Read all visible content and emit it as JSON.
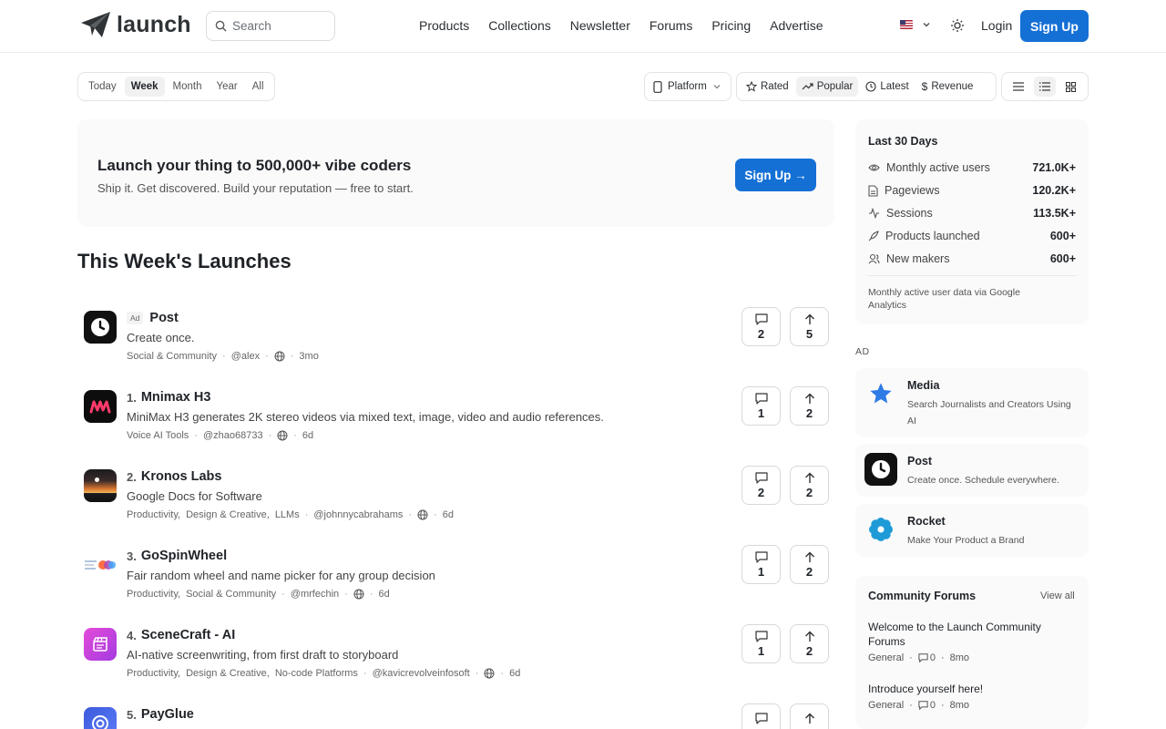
{
  "header": {
    "logo_text": "launch",
    "search_placeholder": "Search",
    "nav": [
      "Products",
      "Collections",
      "Newsletter",
      "Forums",
      "Pricing",
      "Advertise"
    ],
    "login": "Login",
    "signup": "Sign Up"
  },
  "filters": {
    "periods": [
      "Today",
      "Week",
      "Month",
      "Year",
      "All"
    ],
    "active_period": "Week",
    "platform": "Platform",
    "sorts": [
      "Rated",
      "Popular",
      "Latest",
      "Revenue"
    ],
    "active_sort": "Popular"
  },
  "banner": {
    "title": "Launch your thing to 500,000+ vibe coders",
    "subtitle": "Ship it. Get discovered. Build your reputation — free to start.",
    "button": "Sign Up →"
  },
  "section_title": "This Week's Launches",
  "launches": [
    {
      "ad": "Ad",
      "rank": "",
      "title": "Post",
      "tagline": "Create once.",
      "tags": [
        "Social & Community"
      ],
      "user": "@alex",
      "age": "3mo",
      "comments": "2",
      "upvotes": "5"
    },
    {
      "ad": "",
      "rank": "1.",
      "title": "Mnimax H3",
      "tagline": "MiniMax H3 generates 2K stereo videos via mixed text, image, video and audio references.",
      "tags": [
        "Voice AI Tools"
      ],
      "user": "@zhao68733",
      "age": "6d",
      "comments": "1",
      "upvotes": "2"
    },
    {
      "ad": "",
      "rank": "2.",
      "title": "Kronos Labs",
      "tagline": "Google Docs for Software",
      "tags": [
        "Productivity,",
        "Design & Creative,",
        "LLMs"
      ],
      "user": "@johnnycabrahams",
      "age": "6d",
      "comments": "2",
      "upvotes": "2"
    },
    {
      "ad": "",
      "rank": "3.",
      "title": "GoSpinWheel",
      "tagline": "Fair random wheel and name picker for any group decision",
      "tags": [
        "Productivity,",
        "Social & Community"
      ],
      "user": "@mrfechin",
      "age": "6d",
      "comments": "1",
      "upvotes": "2"
    },
    {
      "ad": "",
      "rank": "4.",
      "title": "SceneCraft - AI",
      "tagline": "AI-native screenwriting, from first draft to storyboard",
      "tags": [
        "Productivity,",
        "Design & Creative,",
        "No-code Platforms"
      ],
      "user": "@kavicrevolveinfosoft",
      "age": "6d",
      "comments": "1",
      "upvotes": "2"
    },
    {
      "ad": "",
      "rank": "5.",
      "title": "PayGlue",
      "tagline": "",
      "tags": [],
      "user": "",
      "age": "",
      "comments": "",
      "upvotes": ""
    }
  ],
  "stats": {
    "title": "Last 30 Days",
    "rows": [
      {
        "label": "Monthly active users",
        "value": "721.0K+",
        "icon": "eye-icon"
      },
      {
        "label": "Pageviews",
        "value": "120.2K+",
        "icon": "document-icon"
      },
      {
        "label": "Sessions",
        "value": "113.5K+",
        "icon": "activity-icon"
      },
      {
        "label": "Products launched",
        "value": "600+",
        "icon": "rocket-icon"
      },
      {
        "label": "New makers",
        "value": "600+",
        "icon": "users-icon"
      }
    ],
    "note": "Monthly active user data via Google Analytics"
  },
  "ads": {
    "label": "AD",
    "items": [
      {
        "title": "Media",
        "desc": "Search Journalists and Creators Using AI",
        "icon": "star-icon"
      },
      {
        "title": "Post",
        "desc": "Create once. Schedule everywhere.",
        "icon": "clock-icon"
      },
      {
        "title": "Rocket",
        "desc": "Make Your Product a Brand",
        "icon": "flower-icon"
      }
    ]
  },
  "forums": {
    "title": "Community Forums",
    "view_all": "View all",
    "posts": [
      {
        "title": "Welcome to the Launch Community Forums",
        "category": "General",
        "comments": "0",
        "age": "8mo"
      },
      {
        "title": "Introduce yourself here!",
        "category": "General",
        "comments": "0",
        "age": "8mo"
      }
    ]
  },
  "colors": {
    "primary": "#1570d6"
  }
}
